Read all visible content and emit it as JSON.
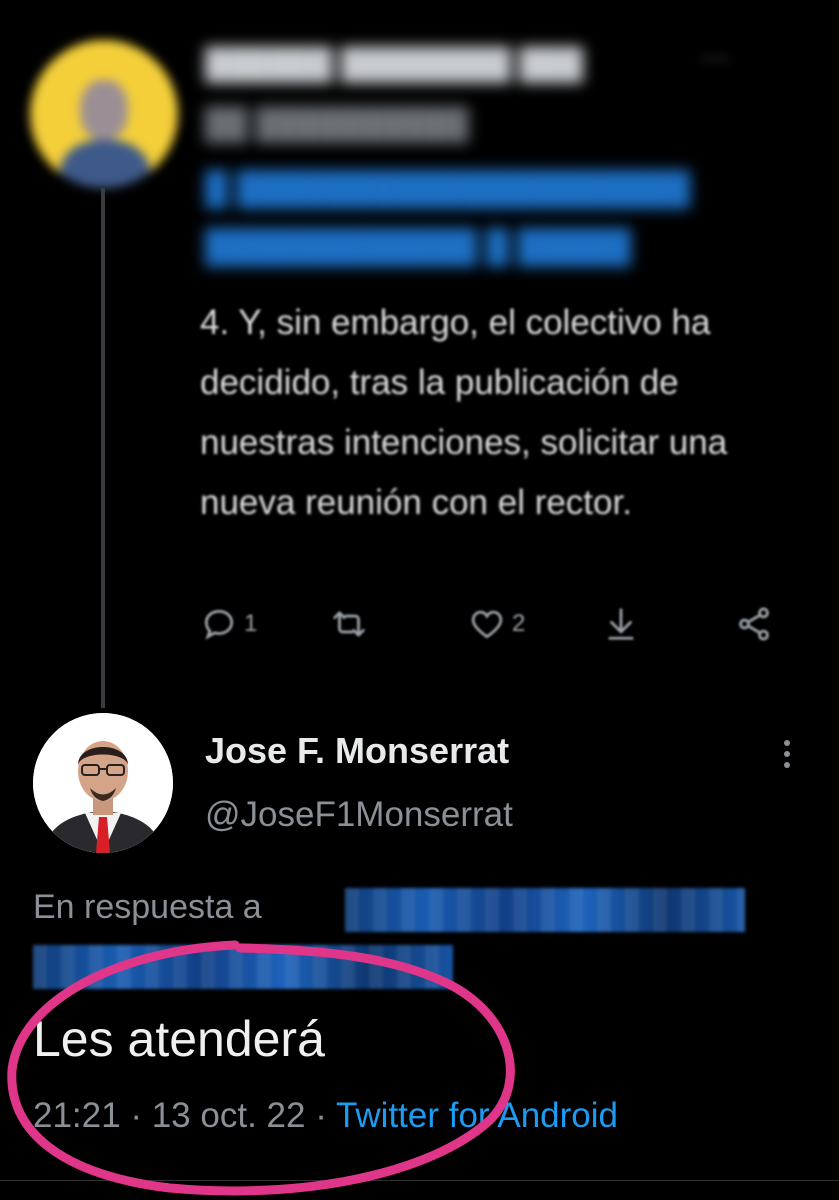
{
  "parent_tweet": {
    "text": "4. Y, sin embargo, el colectivo ha decidido, tras la publicación de nuestras intenciones, solicitar una nueva reunión con el rector.",
    "reply_count": "1",
    "like_count": "2",
    "icons": [
      "reply-icon",
      "retweet-icon",
      "like-icon",
      "download-icon",
      "share-icon"
    ]
  },
  "tweet": {
    "author_name": "Jose F. Monserrat",
    "author_handle": "@JoseF1Monserrat",
    "reply_prefix": "En respuesta a",
    "text": "Les atenderá",
    "time": "21:21",
    "separator": "·",
    "date": "13 oct. 22",
    "source": "Twitter for Android"
  },
  "colors": {
    "background": "#000000",
    "link": "#1d9bf0",
    "annotation_circle": "#e0368a"
  }
}
